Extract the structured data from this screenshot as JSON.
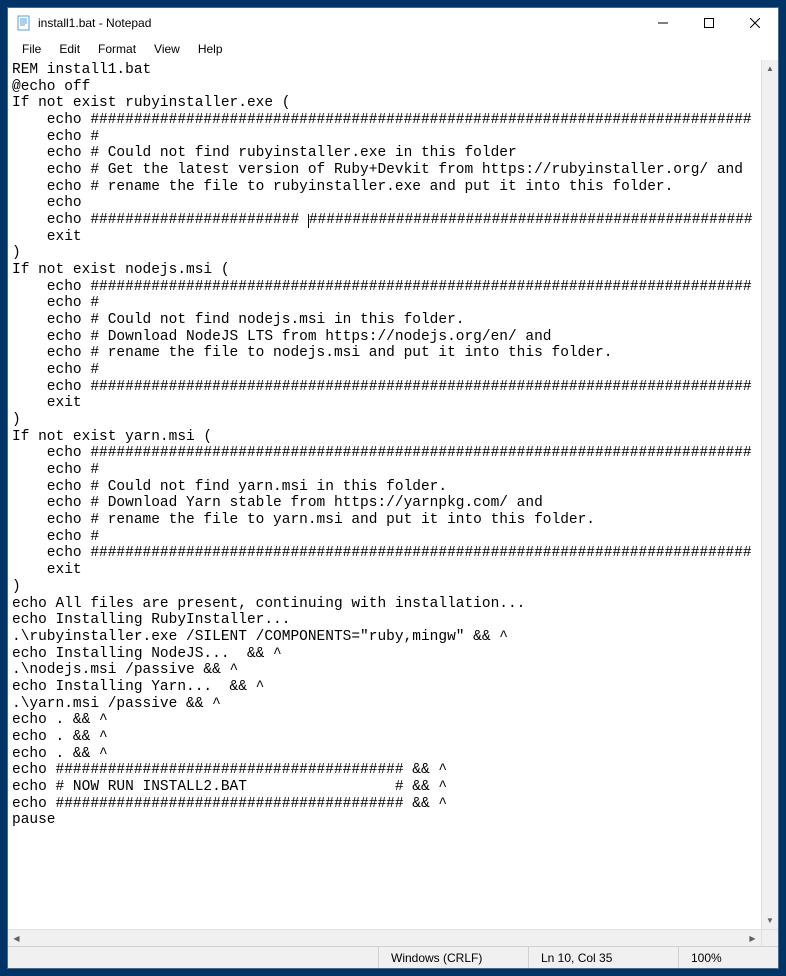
{
  "window": {
    "title": "install1.bat - Notepad"
  },
  "menu": {
    "file": "File",
    "edit": "Edit",
    "format": "Format",
    "view": "View",
    "help": "Help"
  },
  "content": {
    "lines": [
      "REM install1.bat",
      "@echo off",
      "If not exist rubyinstaller.exe (",
      "    echo ############################################################################",
      "    echo #",
      "    echo # Could not find rubyinstaller.exe in this folder",
      "    echo # Get the latest version of Ruby+Devkit from https://rubyinstaller.org/ and",
      "    echo # rename the file to rubyinstaller.exe and put it into this folder.",
      "    echo",
      "    echo ######################## ###################################################",
      "    exit",
      ")",
      "If not exist nodejs.msi (",
      "    echo ############################################################################",
      "    echo #",
      "    echo # Could not find nodejs.msi in this folder.",
      "    echo # Download NodeJS LTS from https://nodejs.org/en/ and",
      "    echo # rename the file to nodejs.msi and put it into this folder.",
      "    echo #",
      "    echo ############################################################################",
      "    exit",
      ")",
      "If not exist yarn.msi (",
      "    echo ############################################################################",
      "    echo #",
      "    echo # Could not find yarn.msi in this folder.",
      "    echo # Download Yarn stable from https://yarnpkg.com/ and",
      "    echo # rename the file to yarn.msi and put it into this folder.",
      "    echo #",
      "    echo ############################################################################",
      "    exit",
      ")",
      "echo All files are present, continuing with installation...",
      "echo Installing RubyInstaller...",
      ".\\rubyinstaller.exe /SILENT /COMPONENTS=\"ruby,mingw\" && ^",
      "echo Installing NodeJS...  && ^",
      ".\\nodejs.msi /passive && ^",
      "echo Installing Yarn...  && ^",
      ".\\yarn.msi /passive && ^",
      "echo . && ^",
      "echo . && ^",
      "echo . && ^",
      "echo ######################################## && ^",
      "echo # NOW RUN INSTALL2.BAT                 # && ^",
      "echo ######################################## && ^",
      "pause",
      ""
    ],
    "cursor_line_index": 9,
    "cursor_col": 34
  },
  "status": {
    "encoding": "Windows (CRLF)",
    "position": "Ln 10, Col 35",
    "zoom": "100%"
  }
}
